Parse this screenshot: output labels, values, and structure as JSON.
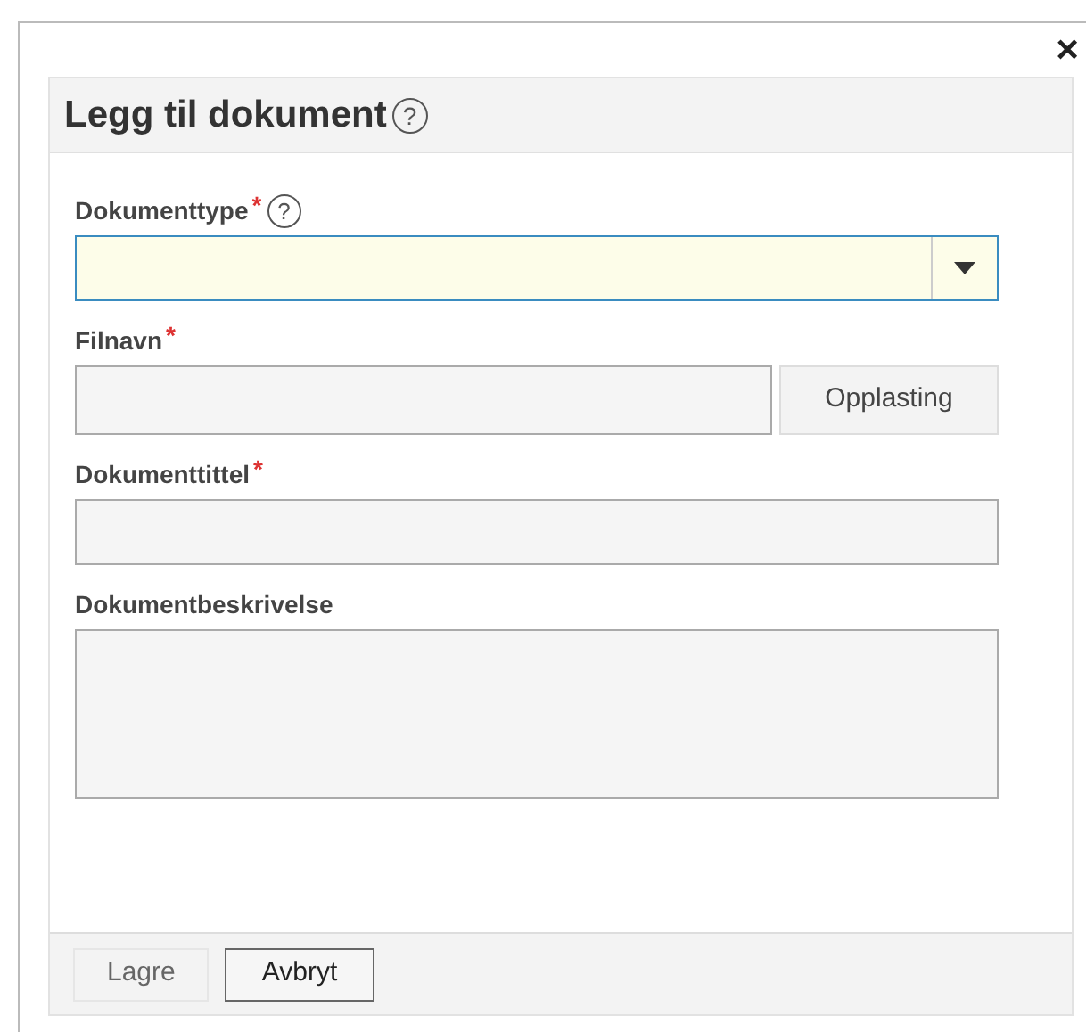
{
  "dialog": {
    "close": "×",
    "title": "Legg til dokument",
    "title_help": "?",
    "fields": [
      {
        "kind": "select",
        "label": "Dokumenttype",
        "required_mark": "*",
        "help": "?",
        "focused": true
      },
      {
        "kind": "file",
        "label": "Filnavn",
        "required_mark": "*",
        "button": "Opplasting"
      },
      {
        "kind": "text",
        "label": "Dokumenttittel",
        "required_mark": "*"
      },
      {
        "kind": "textarea",
        "label": "Dokumentbeskrivelse"
      }
    ],
    "buttons": [
      {
        "label": "Lagre",
        "disabled": true
      },
      {
        "label": "Avbryt",
        "disabled": false
      }
    ]
  }
}
